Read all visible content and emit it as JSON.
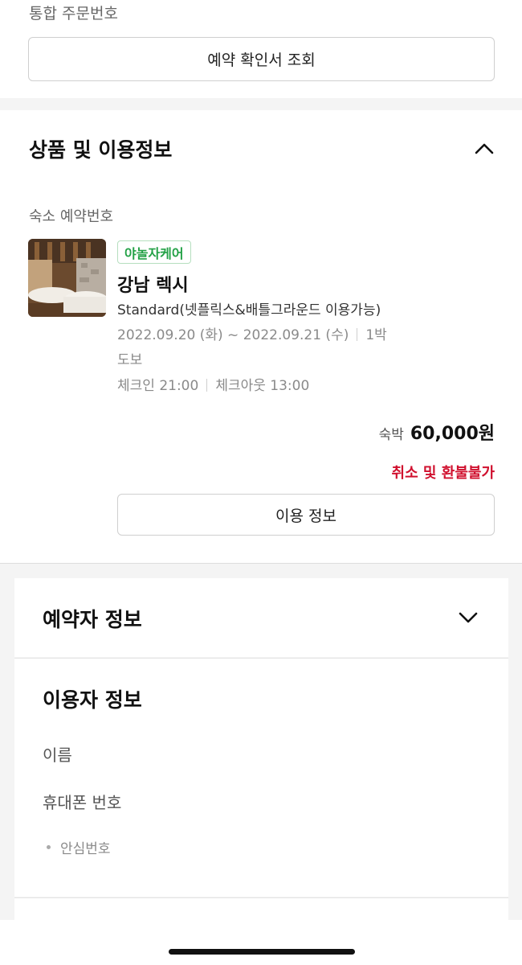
{
  "top": {
    "order_label": "통합 주문번호",
    "confirm_button": "예약 확인서 조회"
  },
  "product": {
    "title": "상품 및 이용정보",
    "stay_booking_label": "숙소 예약번호",
    "badge": "야놀자케어",
    "hotel_name": "강남 렉시",
    "room_type": "Standard(넷플릭스&배틀그라운드 이용가능)",
    "dates": "2022.09.20 (화) ~ 2022.09.21 (수)",
    "nights": "1박",
    "access": "도보",
    "checkin": "체크인 21:00",
    "checkout": "체크아웃 13:00",
    "price_label": "숙박",
    "price_value": "60,000원",
    "refund_notice": "취소 및 환불불가",
    "usage_button": "이용 정보",
    "colors": {
      "badge_green": "#23a146",
      "refund_red": "#d0102e"
    }
  },
  "booker": {
    "title": "예약자 정보"
  },
  "user": {
    "title": "이용자 정보",
    "name_label": "이름",
    "phone_label": "휴대폰 번호",
    "safe_number_label": "안심번호"
  }
}
